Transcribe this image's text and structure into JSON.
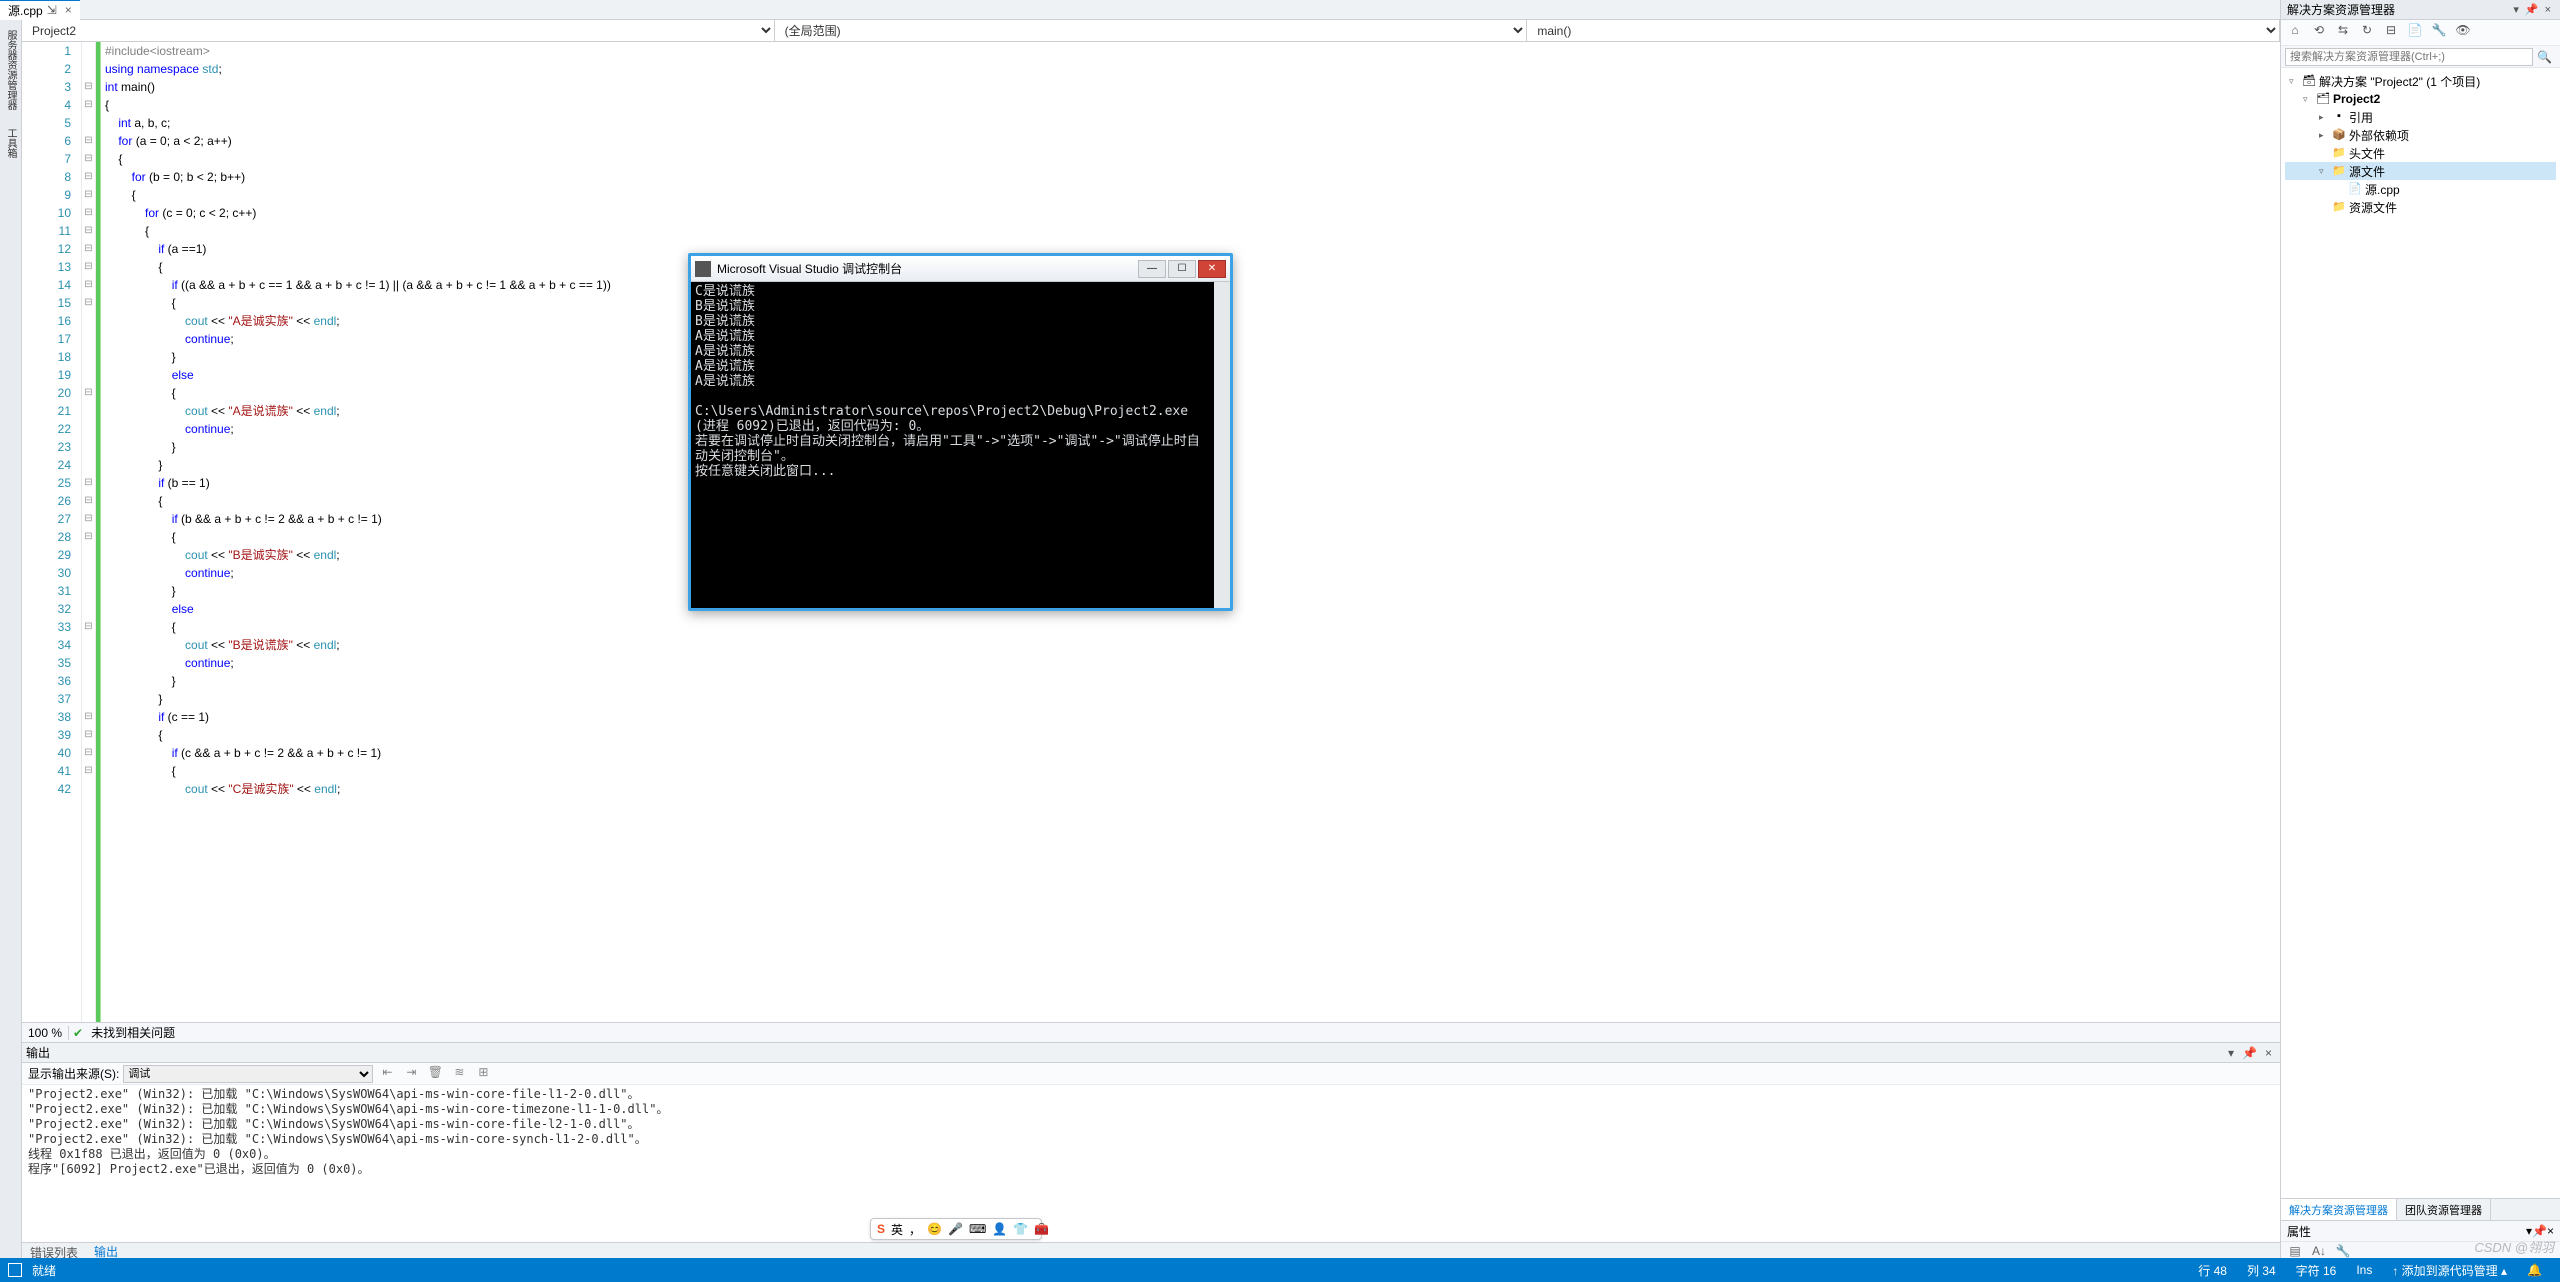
{
  "tab": {
    "label": "源.cpp",
    "close": "×"
  },
  "breadcrumb": {
    "left": "Project2",
    "mid": "(全局范围)",
    "right": "main()"
  },
  "left_rail": {
    "tab1": "服务器资源管理器",
    "tab2": "工具箱"
  },
  "code": {
    "lines": [
      "#include<iostream>",
      "using namespace std;",
      "int main()",
      "{",
      "    int a, b, c;",
      "    for (a = 0; a < 2; a++)",
      "    {",
      "        for (b = 0; b < 2; b++)",
      "        {",
      "            for (c = 0; c < 2; c++)",
      "            {",
      "                if (a ==1)",
      "                {",
      "                    if ((a && a + b + c == 1 && a + b + c != 1) || (a && a + b + c != 1 && a + b + c == 1))",
      "                    {",
      "                        cout << \"A是诚实族\" << endl;",
      "                        continue;",
      "                    }",
      "                    else",
      "                    {",
      "                        cout << \"A是说谎族\" << endl;",
      "                        continue;",
      "                    }",
      "                }",
      "                if (b == 1)",
      "                {",
      "                    if (b && a + b + c != 2 && a + b + c != 1)",
      "                    {",
      "                        cout << \"B是诚实族\" << endl;",
      "                        continue;",
      "                    }",
      "                    else",
      "                    {",
      "                        cout << \"B是说谎族\" << endl;",
      "                        continue;",
      "                    }",
      "                }",
      "                if (c == 1)",
      "                {",
      "                    if (c && a + b + c != 2 && a + b + c != 1)",
      "                    {",
      "                        cout << \"C是诚实族\" << endl;"
    ]
  },
  "editor_status": {
    "zoom": "100 %",
    "check": "✔",
    "msg": "未找到相关问题"
  },
  "output": {
    "title": "输出",
    "source_label": "显示输出来源(S):",
    "source_value": "调试",
    "body": "\"Project2.exe\" (Win32): 已加载 \"C:\\Windows\\SysWOW64\\api-ms-win-core-file-l1-2-0.dll\"。\n\"Project2.exe\" (Win32): 已加载 \"C:\\Windows\\SysWOW64\\api-ms-win-core-timezone-l1-1-0.dll\"。\n\"Project2.exe\" (Win32): 已加载 \"C:\\Windows\\SysWOW64\\api-ms-win-core-file-l2-1-0.dll\"。\n\"Project2.exe\" (Win32): 已加载 \"C:\\Windows\\SysWOW64\\api-ms-win-core-synch-l1-2-0.dll\"。\n线程 0x1f88 已退出，返回值为 0 (0x0)。\n程序\"[6092] Project2.exe\"已退出，返回值为 0 (0x0)。"
  },
  "panel_tabs": {
    "errors": "错误列表",
    "output": "输出"
  },
  "solution": {
    "title": "解决方案资源管理器",
    "search_placeholder": "搜索解决方案资源管理器(Ctrl+;)",
    "root": "解决方案 \"Project2\" (1 个项目)",
    "project": "Project2",
    "refs": "引用",
    "ext": "外部依赖项",
    "headers": "头文件",
    "sources": "源文件",
    "source_file": "源.cpp",
    "resources": "资源文件"
  },
  "rp_tabs": {
    "solution": "解决方案资源管理器",
    "team": "团队资源管理器"
  },
  "props": {
    "title": "属性"
  },
  "statusbar": {
    "ready": "就绪",
    "line": "行 48",
    "col": "列 34",
    "char": "字符 16",
    "ins": "Ins",
    "add_src": "↑ 添加到源代码管理 ▴"
  },
  "console": {
    "title": "Microsoft Visual Studio 调试控制台",
    "body": "C是说谎族\nB是说谎族\nB是说谎族\nA是说谎族\nA是说谎族\nA是说谎族\nA是说谎族\n\nC:\\Users\\Administrator\\source\\repos\\Project2\\Debug\\Project2.exe (进程 6092)已退出，返回代码为: 0。\n若要在调试停止时自动关闭控制台，请启用\"工具\"->\"选项\"->\"调试\"->\"调试停止时自动关闭控制台\"。\n按任意键关闭此窗口..."
  },
  "ime": {
    "label": "英"
  },
  "watermark": "CSDN @翎羽"
}
